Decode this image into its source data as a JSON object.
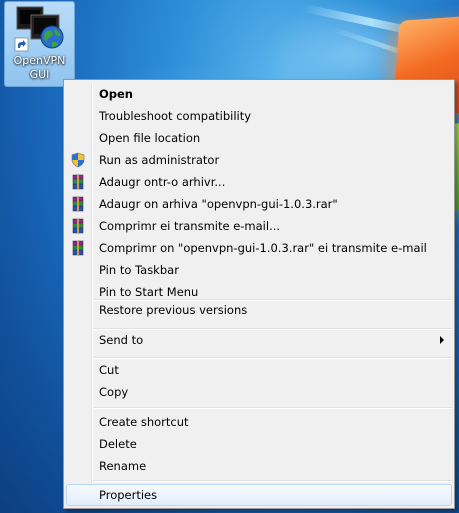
{
  "desktop": {
    "icon": {
      "label_line1": "OpenVPN",
      "label_line2": "GUI",
      "icon_name": "openvpn-gui-shortcut-icon"
    }
  },
  "context_menu": {
    "items": [
      {
        "label": "Open",
        "bold": true,
        "icon": null
      },
      {
        "label": "Troubleshoot compatibility",
        "icon": null
      },
      {
        "label": "Open file location",
        "icon": null
      },
      {
        "label": "Run as administrator",
        "icon": "uac-shield-icon"
      },
      {
        "label": "Adaugr ontr-o arhivr...",
        "icon": "winrar-icon"
      },
      {
        "label": "Adaugr on arhiva \"openvpn-gui-1.0.3.rar\"",
        "icon": "winrar-icon"
      },
      {
        "label": "Comprimr ei transmite e-mail...",
        "icon": "winrar-icon"
      },
      {
        "label": "Comprimr on \"openvpn-gui-1.0.3.rar\" ei transmite e-mail",
        "icon": "winrar-icon"
      },
      {
        "label": "Pin to Taskbar",
        "icon": null
      },
      {
        "label": "Pin to Start Menu",
        "icon": null
      },
      {
        "label": "Restore previous versions",
        "icon": null
      },
      {
        "label": "Send to",
        "icon": null,
        "submenu": true
      },
      {
        "label": "Cut",
        "icon": null
      },
      {
        "label": "Copy",
        "icon": null
      },
      {
        "label": "Create shortcut",
        "icon": null
      },
      {
        "label": "Delete",
        "icon": null
      },
      {
        "label": "Rename",
        "icon": null
      },
      {
        "label": "Properties",
        "icon": null,
        "highlighted": true
      }
    ]
  },
  "colors": {
    "menu_background": "#f0f0f0",
    "menu_border": "#979797",
    "highlight_fill": "#e3eefb",
    "highlight_border": "#b8d6fb",
    "desktop_blue": "#1a6bbf"
  }
}
